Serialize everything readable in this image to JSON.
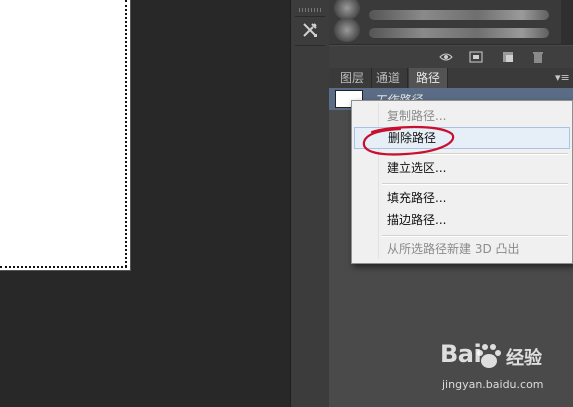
{
  "panel": {
    "tabs": [
      {
        "label": "图层"
      },
      {
        "label": "通道"
      },
      {
        "label": "路径"
      }
    ],
    "menu_glyph": "▾≡",
    "path_item": {
      "name": "工作路径"
    }
  },
  "context_menu": {
    "items": [
      {
        "label": "复制路径...",
        "enabled": false
      },
      {
        "label": "删除路径",
        "enabled": true
      },
      {
        "label": "建立选区...",
        "enabled": true
      },
      {
        "label": "填充路径...",
        "enabled": true
      },
      {
        "label": "描边路径...",
        "enabled": true
      },
      {
        "label": "从所选路径新建 3D 凸出",
        "enabled": false
      }
    ]
  },
  "watermark": {
    "brand": "Bai",
    "brand_cn": "经验",
    "url": "jingyan.baidu.com"
  },
  "colors": {
    "selected_row": "#5b6d86",
    "annotation": "#c8102e"
  },
  "icons": [
    "tools-icon",
    "eye-icon",
    "mask-icon",
    "new-path-icon",
    "trash-icon",
    "panel-menu-icon"
  ]
}
